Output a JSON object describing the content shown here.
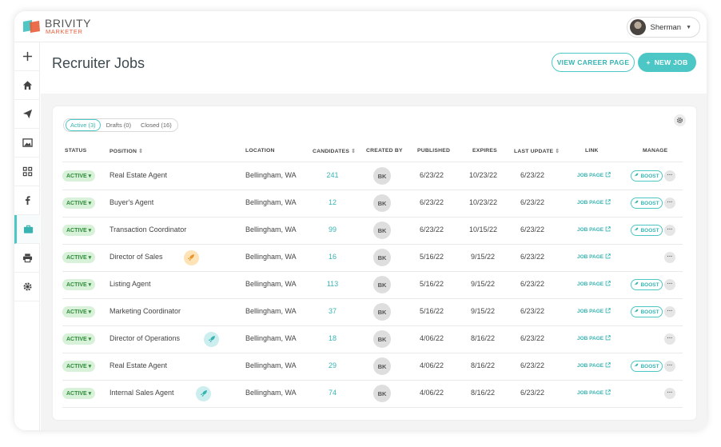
{
  "brand": {
    "name": "BRIVITY",
    "sub": "MARKETER",
    "accent": "#4dc7c5",
    "orange": "#e85d3a"
  },
  "user": {
    "name": "Sherman"
  },
  "sidebar": [
    {
      "name": "add-icon"
    },
    {
      "name": "home-icon"
    },
    {
      "name": "send-icon"
    },
    {
      "name": "image-icon"
    },
    {
      "name": "grid-icon"
    },
    {
      "name": "facebook-icon"
    },
    {
      "name": "briefcase-icon",
      "active": true
    },
    {
      "name": "print-icon"
    },
    {
      "name": "settings-icon"
    }
  ],
  "header": {
    "title": "Recruiter Jobs",
    "career_button": "VIEW CAREER PAGE",
    "new_job_button": "NEW JOB",
    "new_job_plus": "+"
  },
  "filters": [
    {
      "label": "Active (3)",
      "active": true
    },
    {
      "label": "Drafts (0)"
    },
    {
      "label": "Closed (16)"
    }
  ],
  "columns": {
    "status": "STATUS",
    "position": "POSITION",
    "location": "LOCATION",
    "candidates": "CANDIDATES",
    "created_by": "CREATED BY",
    "published": "PUBLISHED",
    "expires": "EXPIRES",
    "last_update": "LAST UPDATE",
    "link": "LINK",
    "manage": "MANAGE"
  },
  "labels": {
    "status": "ACTIVE",
    "link": "JOB PAGE",
    "boost": "BOOST",
    "more": "···"
  },
  "rows": [
    {
      "position": "Real Estate Agent",
      "location": "Bellingham, WA",
      "candidates": "241",
      "created_by": "BK",
      "published": "6/23/22",
      "expires": "10/23/22",
      "last_update": "6/23/22",
      "boost": true,
      "rocket": null
    },
    {
      "position": "Buyer's Agent",
      "location": "Bellingham, WA",
      "candidates": "12",
      "created_by": "BK",
      "published": "6/23/22",
      "expires": "10/23/22",
      "last_update": "6/23/22",
      "boost": true,
      "rocket": null
    },
    {
      "position": "Transaction Coordinator",
      "location": "Bellingham, WA",
      "candidates": "99",
      "created_by": "BK",
      "published": "6/23/22",
      "expires": "10/15/22",
      "last_update": "6/23/22",
      "boost": true,
      "rocket": null
    },
    {
      "position": "Director of Sales",
      "location": "Bellingham, WA",
      "candidates": "16",
      "created_by": "BK",
      "published": "5/16/22",
      "expires": "9/15/22",
      "last_update": "6/23/22",
      "boost": false,
      "rocket": "orange"
    },
    {
      "position": "Listing Agent",
      "location": "Bellingham, WA",
      "candidates": "113",
      "created_by": "BK",
      "published": "5/16/22",
      "expires": "9/15/22",
      "last_update": "6/23/22",
      "boost": true,
      "rocket": null
    },
    {
      "position": "Marketing Coordinator",
      "location": "Bellingham, WA",
      "candidates": "37",
      "created_by": "BK",
      "published": "5/16/22",
      "expires": "9/15/22",
      "last_update": "6/23/22",
      "boost": true,
      "rocket": null
    },
    {
      "position": "Director of Operations",
      "location": "Bellingham, WA",
      "candidates": "18",
      "created_by": "BK",
      "published": "4/06/22",
      "expires": "8/16/22",
      "last_update": "6/23/22",
      "boost": false,
      "rocket": "teal"
    },
    {
      "position": "Real Estate Agent",
      "location": "Bellingham, WA",
      "candidates": "29",
      "created_by": "BK",
      "published": "4/06/22",
      "expires": "8/16/22",
      "last_update": "6/23/22",
      "boost": true,
      "rocket": null
    },
    {
      "position": "Internal Sales Agent",
      "location": "Bellingham, WA",
      "candidates": "74",
      "created_by": "BK",
      "published": "4/06/22",
      "expires": "8/16/22",
      "last_update": "6/23/22",
      "boost": false,
      "rocket": "teal"
    }
  ]
}
